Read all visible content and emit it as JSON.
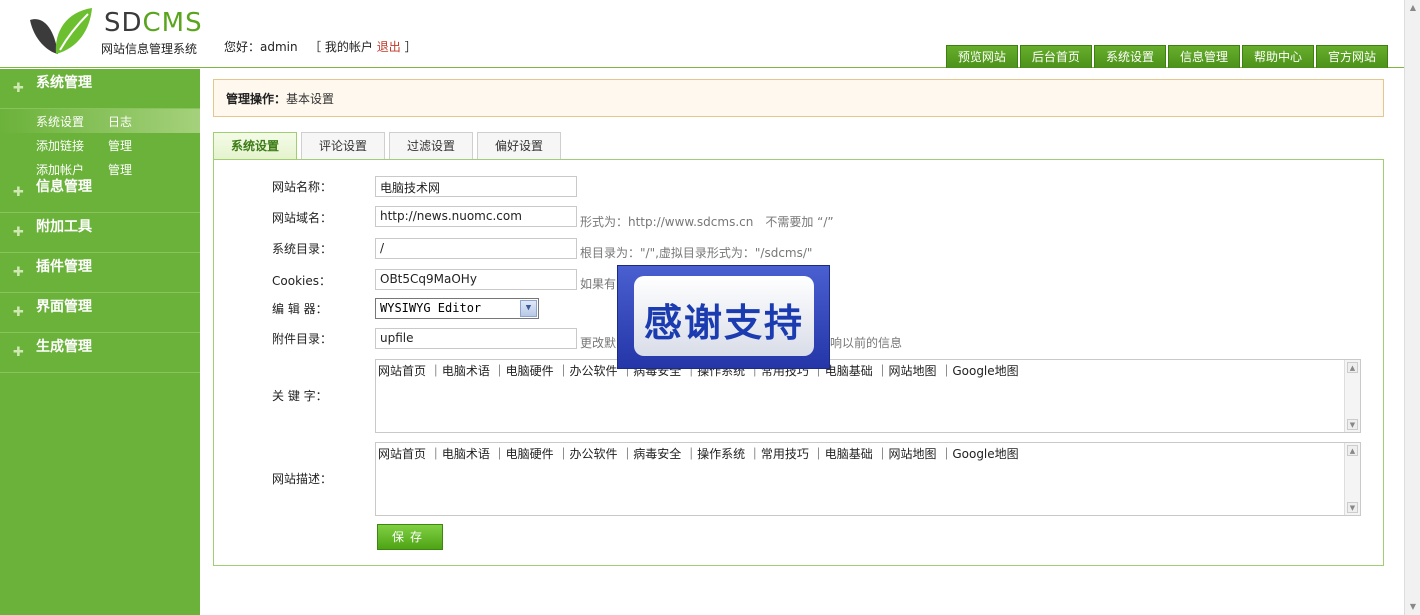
{
  "header": {
    "logo_sd": "SD",
    "logo_cms": "CMS",
    "logo_sub": "网站信息管理系统",
    "greeting_prefix": "您好：admin",
    "account_open": "［ 我的帐户",
    "logout": "退出",
    "account_close": "］",
    "nav": [
      "预览网站",
      "后台首页",
      "系统设置",
      "信息管理",
      "帮助中心",
      "官方网站"
    ]
  },
  "sidebar": {
    "groups": [
      {
        "title": "系统管理",
        "subs": [
          {
            "a": "系统设置",
            "b": "日志",
            "active": true
          },
          {
            "a": "添加链接",
            "b": "管理",
            "active": false
          },
          {
            "a": "添加帐户",
            "b": "管理",
            "active": false
          }
        ]
      },
      {
        "title": "信息管理"
      },
      {
        "title": "附加工具"
      },
      {
        "title": "插件管理"
      },
      {
        "title": "界面管理"
      },
      {
        "title": "生成管理"
      }
    ]
  },
  "breadcrumb": {
    "label": "管理操作：",
    "current": "基本设置"
  },
  "tabs": [
    "系统设置",
    "评论设置",
    "过滤设置",
    "偏好设置"
  ],
  "form": {
    "site_name": {
      "label": "网站名称：",
      "value": "电脑技术网"
    },
    "site_domain": {
      "label": "网站域名：",
      "value": "http://news.nuomc.com",
      "hint": "形式为：http://www.sdcms.cn　不需要加 “/”"
    },
    "sys_dir": {
      "label": "系统目录：",
      "value": "/",
      "hint": "根目录为：\"/\",虚拟目录形式为：\"/sdcms/\""
    },
    "cookies": {
      "label": "Cookies：",
      "value": "OBt5Cq9MaOHy",
      "hint": "如果有"
    },
    "editor": {
      "label": "编 辑 器：",
      "value": "WYSIWYG Editor"
    },
    "upload_dir": {
      "label": "附件目录：",
      "value": "upfile",
      "hint_left": "更改默",
      "hint_right": "影响以前的信息"
    },
    "keywords": {
      "label": "关 键 字：",
      "value": "网站首页 ｜电脑术语 ｜电脑硬件 ｜办公软件 ｜病毒安全 ｜操作系统 ｜常用技巧 ｜电脑基础 ｜网站地图 ｜Google地图"
    },
    "description": {
      "label": "网站描述：",
      "value": "网站首页 ｜电脑术语 ｜电脑硬件 ｜办公软件 ｜病毒安全 ｜操作系统 ｜常用技巧 ｜电脑基础 ｜网站地图 ｜Google地图"
    },
    "save_label": "保存"
  },
  "overlay": {
    "text": "感谢支持"
  },
  "icons": {
    "sidebar_expand": "plus-icon",
    "select_arrow": "chevron-down-icon",
    "scroll_up": "arrow-up-icon",
    "scroll_down": "arrow-down-icon"
  }
}
